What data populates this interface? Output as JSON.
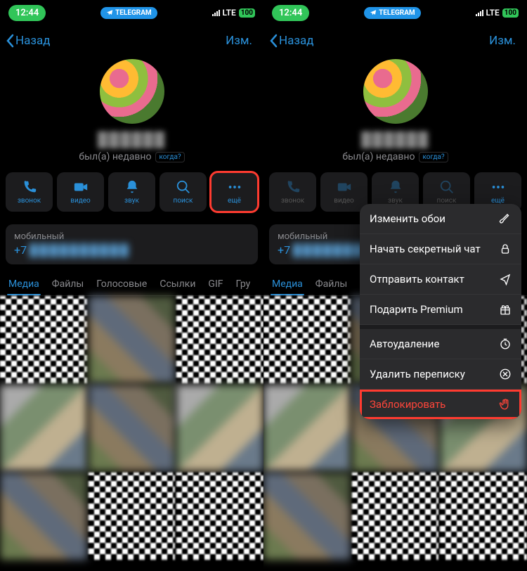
{
  "status": {
    "time": "12:44",
    "app_label": "TELEGRAM",
    "network": "LTE",
    "battery": "100"
  },
  "nav": {
    "back": "Назад",
    "edit": "Изм."
  },
  "profile": {
    "name": "██████",
    "last_seen": "был(а) недавно",
    "when": "когда?"
  },
  "actions": {
    "call": "звонок",
    "video": "видео",
    "mute": "звук",
    "search": "поиск",
    "more": "ещё"
  },
  "phone": {
    "label": "мобильный",
    "prefix": "+7",
    "rest": "██████████"
  },
  "tabs": {
    "media": "Медиа",
    "files": "Файлы",
    "voice": "Голосовые",
    "links": "Ссылки",
    "gif": "GIF",
    "groups": "Гру"
  },
  "menu": {
    "wallpaper": "Изменить обои",
    "secret": "Начать секретный чат",
    "send_contact": "Отправить контакт",
    "gift": "Подарить Premium",
    "autodelete": "Автоудаление",
    "clear": "Удалить переписку",
    "block": "Заблокировать"
  }
}
